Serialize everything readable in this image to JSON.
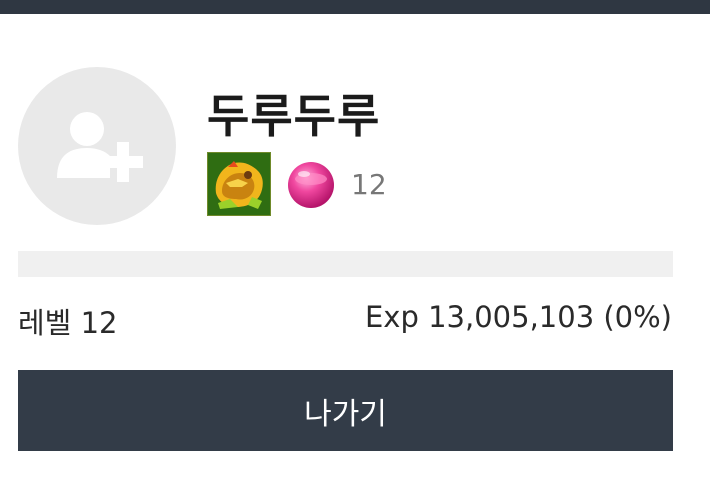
{
  "profile": {
    "username": "두루두루",
    "avatar_icon": "add-user-icon",
    "guild_emblem_icon": "guild-emblem-icon",
    "gem_icon": "pink-gem-icon",
    "gem_count": "12"
  },
  "progress": {
    "fraction": 0.0
  },
  "stats": {
    "level_text": "레벨 12",
    "exp_text": "Exp 13,005,103 (0%)"
  },
  "actions": {
    "exit_label": "나가기"
  },
  "colors": {
    "header": "#2f3742",
    "button": "#333c48",
    "avatar_bg": "#e9e9e9"
  }
}
